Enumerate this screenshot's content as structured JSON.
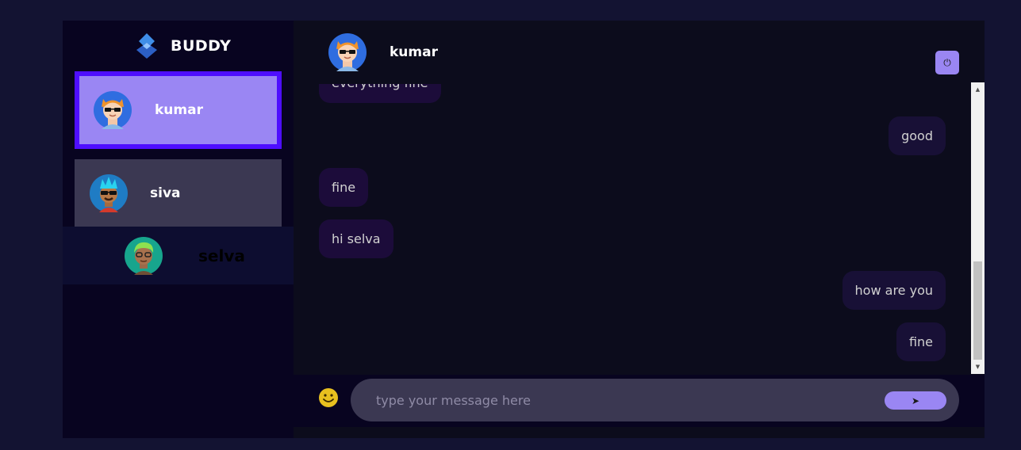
{
  "brand": {
    "name": "BUDDY"
  },
  "contacts": [
    {
      "name": "kumar",
      "state": "selected"
    },
    {
      "name": "siva",
      "state": "normal"
    },
    {
      "name": "selva",
      "state": "normal"
    }
  ],
  "chat": {
    "header_name": "kumar",
    "logout_icon": "⏻",
    "messages": [
      {
        "text": "everything fine",
        "from": "them"
      },
      {
        "text": "good",
        "from": "me"
      },
      {
        "text": "fine",
        "from": "them"
      },
      {
        "text": "hi selva",
        "from": "them"
      },
      {
        "text": "how are you",
        "from": "me"
      },
      {
        "text": "fine",
        "from": "me"
      }
    ]
  },
  "composer": {
    "placeholder": "type your message here",
    "send_icon": "➤"
  },
  "colors": {
    "accent": "#9a86f3",
    "selected_border": "#4e0eff",
    "background": "#131332",
    "sidebar_bg": "#080420"
  }
}
